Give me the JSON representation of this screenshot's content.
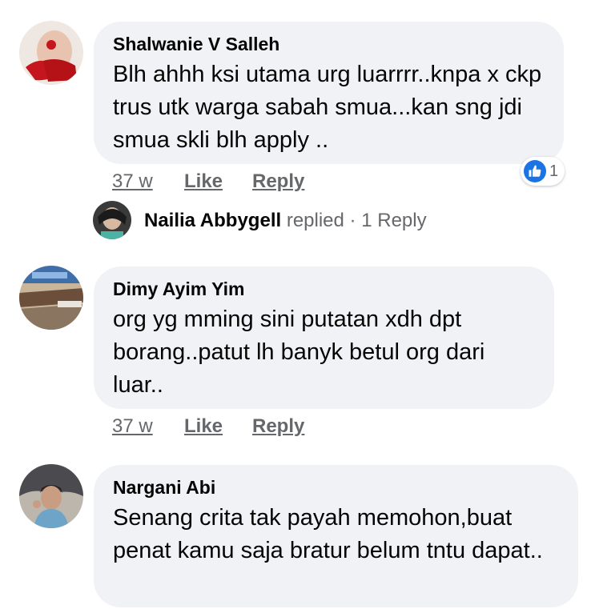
{
  "comments": [
    {
      "author": "Shalwanie V Salleh",
      "text": "Blh ahhh ksi utama urg luarrrr..knpa x ckp trus utk warga sabah smua...kan sng jdi smua skli blh apply ..",
      "time": "37 w",
      "like_label": "Like",
      "reply_label": "Reply",
      "reaction_count": "1",
      "reply_summary": {
        "name": "Nailia Abbygell",
        "action": "replied",
        "separator": "·",
        "count_label": "1 Reply"
      }
    },
    {
      "author": "Dimy Ayim Yim",
      "text": "org yg mming sini putatan xdh dpt borang..patut lh banyk betul org dari luar..",
      "time": "37 w",
      "like_label": "Like",
      "reply_label": "Reply"
    },
    {
      "author": "Nargani Abi",
      "text": "Senang crita tak payah memohon,buat penat kamu saja bratur belum tntu dapat.."
    }
  ],
  "icons": {
    "reaction": "like-thumb-icon"
  },
  "colors": {
    "bubble": "#f0f2f5",
    "secondary_text": "#65676b",
    "like_blue": "#1b74e4"
  }
}
